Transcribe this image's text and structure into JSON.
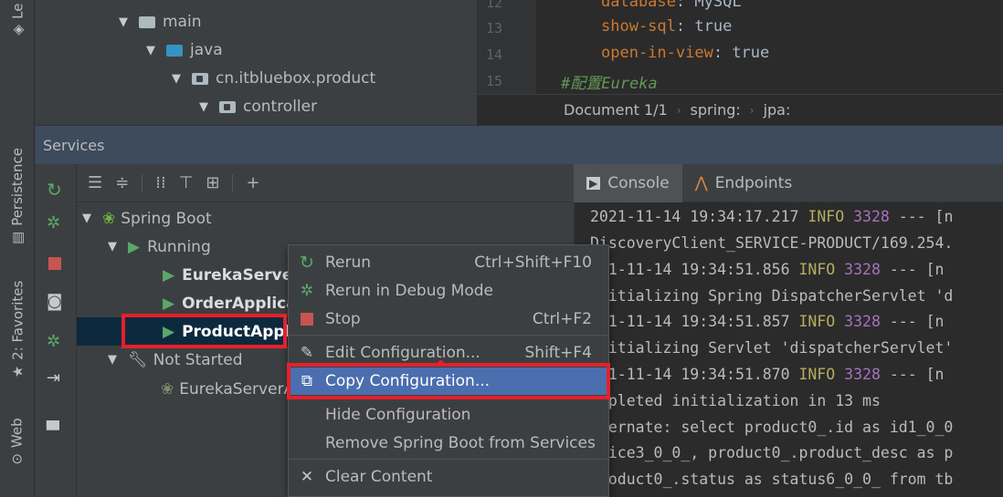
{
  "left_strip": {
    "tabs": [
      {
        "label": "Le",
        "icon": "learn-icon"
      },
      {
        "label": "Persistence",
        "icon": "persistence-icon"
      },
      {
        "label": "2: Favorites",
        "icon": "star-icon"
      },
      {
        "label": "Web",
        "icon": "web-icon"
      }
    ]
  },
  "project_tree": {
    "items": [
      {
        "label": "main",
        "folder": "gray"
      },
      {
        "label": "java",
        "folder": "blue"
      },
      {
        "label": "cn.itbluebox.product",
        "folder": "package"
      },
      {
        "label": "controller",
        "folder": "package"
      }
    ]
  },
  "editor": {
    "lines": [
      {
        "num": "12",
        "key": "database",
        "value": "MySQL"
      },
      {
        "num": "13",
        "key": "show-sql",
        "value": "true"
      },
      {
        "num": "14",
        "key": "open-in-view",
        "value": "true"
      },
      {
        "num": "15",
        "comment": "#配置Eureka"
      }
    ],
    "breadcrumb": [
      "Document 1/1",
      "spring:",
      "jpa:"
    ]
  },
  "services": {
    "title": "Services",
    "tree": {
      "spring_boot": "Spring Boot",
      "running": "Running",
      "running_items": [
        "EurekaServer",
        "OrderApplica",
        "ProductAppli"
      ],
      "not_started": "Not Started",
      "not_started_items": [
        "EurekaServerA"
      ]
    }
  },
  "console": {
    "tabs": [
      {
        "label": "Console",
        "active": true
      },
      {
        "label": "Endpoints",
        "active": false
      }
    ],
    "lines": [
      {
        "pre": "2021-11-14 19:34:17.217",
        "level": "INFO",
        "pid": "3328",
        "post": "--- [n"
      },
      {
        "text": " DiscoveryClient_SERVICE-PRODUCT/169.254."
      },
      {
        "pre": ")21-11-14 19:34:51.856",
        "level": "INFO",
        "pid": "3328",
        "post": "--- [n"
      },
      {
        "text": "Initializing Spring DispatcherServlet 'd"
      },
      {
        "pre": ")21-11-14 19:34:51.857",
        "level": "INFO",
        "pid": "3328",
        "post": "--- [n"
      },
      {
        "text": "Initializing Servlet 'dispatcherServlet'"
      },
      {
        "pre": ")21-11-14 19:34:51.870",
        "level": "INFO",
        "pid": "3328",
        "post": "--- [n"
      },
      {
        "text": "ompleted initialization in 13 ms"
      },
      {
        "text": "ibernate: select product0_.id as id1_0_0"
      },
      {
        "text": "orice3_0_0_, product0_.product_desc as p"
      },
      {
        "text": "oroduct0_.status as status6_0_0_ from tb"
      }
    ]
  },
  "context_menu": {
    "items": [
      {
        "label": "Rerun",
        "shortcut": "Ctrl+Shift+F10",
        "icon": "rerun-icon"
      },
      {
        "label": "Rerun in Debug Mode",
        "shortcut": "",
        "icon": "debug-icon"
      },
      {
        "label": "Stop",
        "shortcut": "Ctrl+F2",
        "icon": "stop-icon"
      },
      {
        "label": "Edit Configuration...",
        "shortcut": "Shift+F4",
        "icon": "edit-icon"
      },
      {
        "label": "Copy Configuration...",
        "shortcut": "",
        "icon": "copy-icon",
        "highlighted": true
      },
      {
        "label": "Hide Configuration",
        "shortcut": "",
        "icon": ""
      },
      {
        "label": "Remove Spring Boot from Services",
        "shortcut": "",
        "icon": ""
      },
      {
        "label": "Clear Content",
        "shortcut": "",
        "icon": "close-icon"
      }
    ]
  },
  "colors": {
    "accent": "#4b6eaf",
    "annotation_red": "#e5202b",
    "run_green": "#59a869",
    "selected_row": "#0d293e"
  }
}
